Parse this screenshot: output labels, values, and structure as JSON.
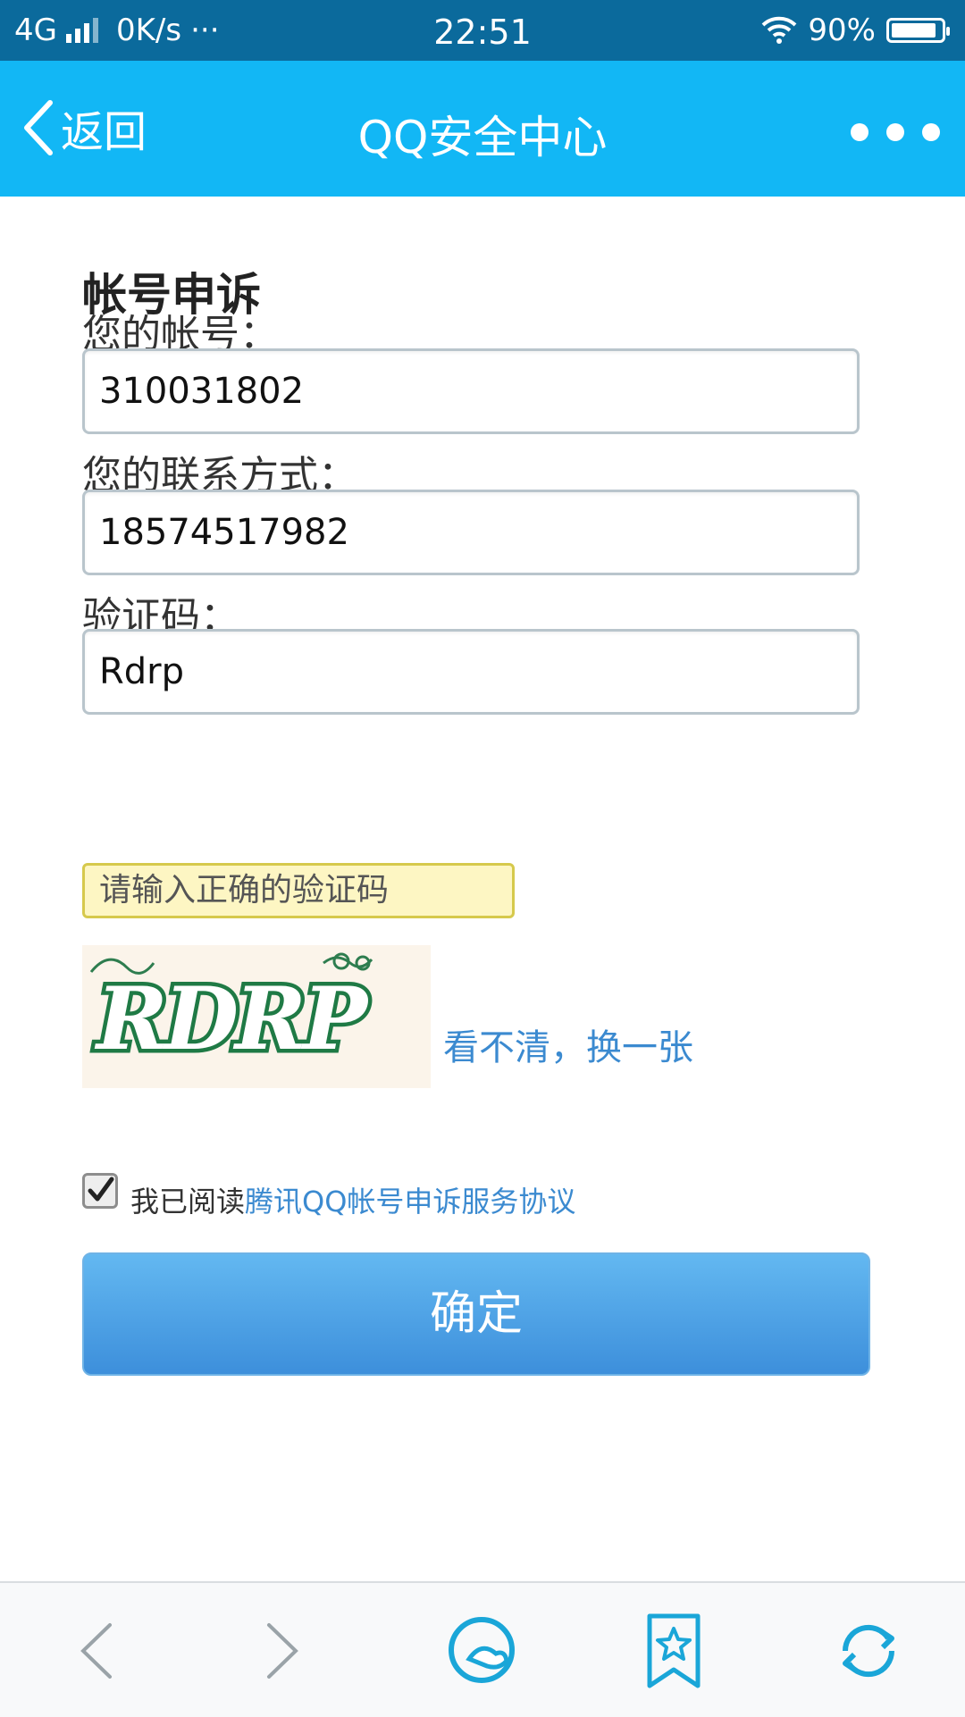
{
  "status_bar": {
    "network": "4G",
    "speed": "0K/s",
    "more": "···",
    "time": "22:51",
    "battery": "90%",
    "battery_level": 0.9
  },
  "title_bar": {
    "back_label": "返回",
    "title": "QQ安全中心"
  },
  "form": {
    "heading": "帐号申诉",
    "account_label": "您的帐号：",
    "account_value": "310031802",
    "contact_label": "您的联系方式：",
    "contact_value": "18574517982",
    "captcha_label": "验证码：",
    "captcha_value": "Rdrp",
    "error_message": "请输入正确的验证码",
    "captcha_image_text": "RDRP",
    "refresh_link": "看不清，换一张",
    "agree_prefix": "我已阅读",
    "agree_link": "腾讯QQ帐号申诉服务协议",
    "agree_checked": true,
    "confirm_label": "确定"
  },
  "toolbar": {
    "icons": [
      "back-arrow-icon",
      "forward-arrow-icon",
      "qq-browser-icon",
      "bookmark-star-icon",
      "refresh-icon"
    ]
  },
  "colors": {
    "status_bar": "#0b6a9c",
    "title_bar": "#12b7f5",
    "link": "#3b8ad0",
    "button": "#4fa3e6",
    "error_bg": "#fdf6c3"
  }
}
